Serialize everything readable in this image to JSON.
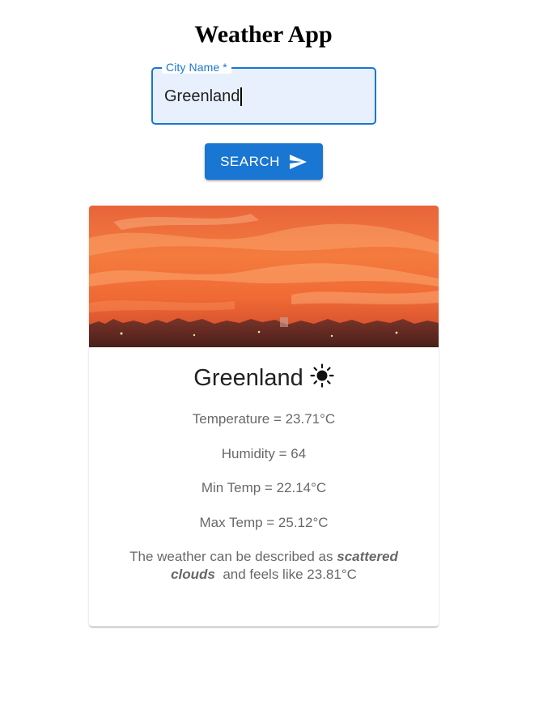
{
  "app": {
    "title": "Weather App"
  },
  "search": {
    "label": "City Name *",
    "value": "Greenland",
    "button_label": "SEARCH",
    "button_icon": "send-icon"
  },
  "weather": {
    "city": "Greenland",
    "condition_icon": "sun-icon",
    "temperature": "Temperature = 23.71°C",
    "humidity": "Humidity = 64",
    "min_temp": "Min Temp = 22.14°C",
    "max_temp": "Max Temp = 25.12°C",
    "description_prefix": "The weather can be described as",
    "description_condition": "scattered clouds",
    "description_suffix": "and feels like 23.81°C"
  },
  "colors": {
    "primary": "#1976d2",
    "input_bg": "#e8f0fe",
    "sunset_orange": "#f2733a",
    "sunset_dark": "#5a2a24"
  }
}
